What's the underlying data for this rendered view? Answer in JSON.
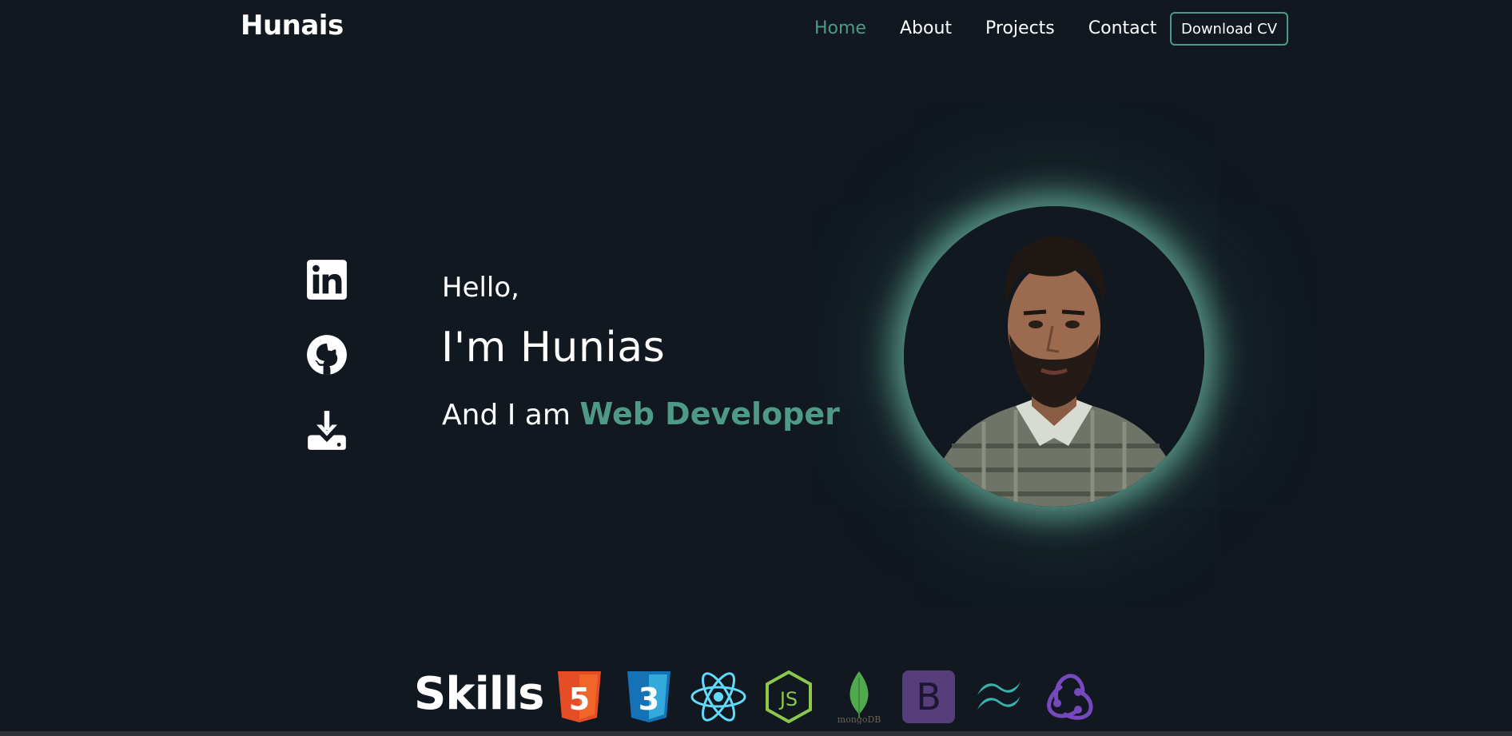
{
  "navbar": {
    "brand": "Hunais",
    "links": [
      {
        "label": "Home",
        "active": true
      },
      {
        "label": "About",
        "active": false
      },
      {
        "label": "Projects",
        "active": false
      },
      {
        "label": "Contact",
        "active": false
      }
    ],
    "cv_button": "Download CV"
  },
  "social": {
    "icons": [
      "linkedin-icon",
      "github-icon",
      "download-icon"
    ]
  },
  "hero": {
    "greeting": "Hello,",
    "name": "I'm Hunias",
    "role_prefix": "And I am",
    "role": "Web Developer"
  },
  "skills": {
    "title": "Skills",
    "icons": [
      "html5-icon",
      "css3-icon",
      "react-icon",
      "nodejs-icon",
      "mongodb-icon",
      "bootstrap-icon",
      "tailwind-icon",
      "redux-icon"
    ],
    "mongodb_wordmark": "mongoDB",
    "bootstrap_letter": "B",
    "html_number": "5",
    "css_number": "3",
    "node_label": "JS"
  },
  "colors": {
    "background": "#111820",
    "accent": "#4f9a87",
    "text": "#ffffff"
  }
}
